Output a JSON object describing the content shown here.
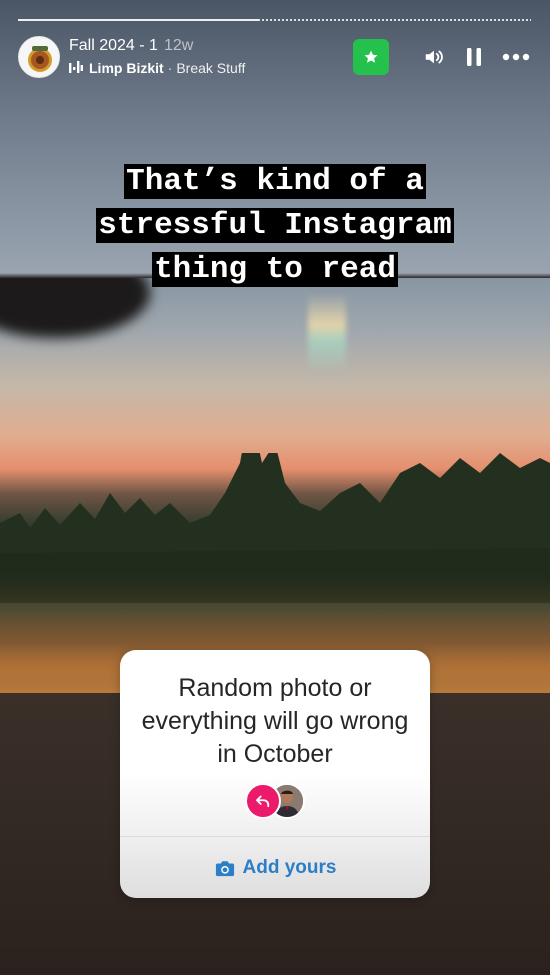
{
  "story": {
    "progress_fraction": 0.47
  },
  "header": {
    "title": "Fall 2024 - 1",
    "age": "12w",
    "music": {
      "artist": "Limp Bizkit",
      "separator": "·",
      "song": "Break Stuff"
    },
    "icons": {
      "close_friends": "star-icon",
      "sound": "speaker-icon",
      "pause": "pause-icon",
      "more": "more-options-icon"
    },
    "accent_color": "#24c24d"
  },
  "caption": {
    "lines": [
      "That’s kind of a",
      "stressful Instagram",
      "thing to read"
    ]
  },
  "add_yours_sticker": {
    "prompt": "Random photo or everything will go wrong in October",
    "button_label": "Add yours",
    "button_color": "#2c7fc6",
    "reply_badge_color": "#ec1a6b"
  }
}
